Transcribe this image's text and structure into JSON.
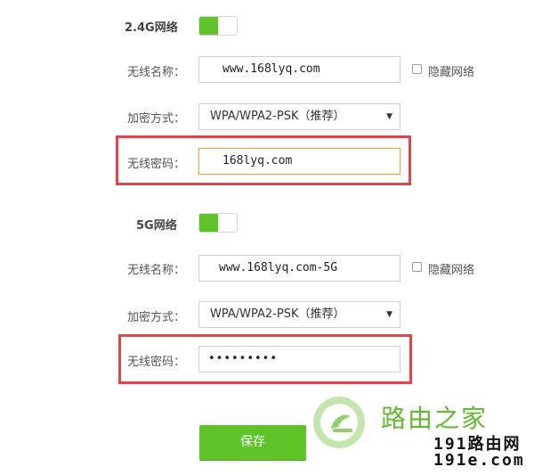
{
  "wifi_24g": {
    "section_label": "2.4G网络",
    "enabled": true,
    "ssid_label": "无线名称：",
    "ssid_value": "www.168lyq.com",
    "hide_label": "隐藏网络",
    "hidden": false,
    "security_label": "加密方式：",
    "security_value": "WPA/WPA2-PSK（推荐）",
    "password_label": "无线密码：",
    "password_value": "168lyq.com"
  },
  "wifi_5g": {
    "section_label": "5G网络",
    "enabled": true,
    "ssid_label": "无线名称：",
    "ssid_value": "www.168lyq.com-5G",
    "hide_label": "隐藏网络",
    "hidden": false,
    "security_label": "加密方式：",
    "security_value": "WPA/WPA2-PSK（推荐）",
    "password_label": "无线密码：",
    "password_masked": "•••••••••"
  },
  "save_label": "保存",
  "watermark": {
    "name": "路由之家",
    "url_line1": "191路由网",
    "url_line2": "191e.com"
  },
  "colors": {
    "accent_green": "#5ec42a",
    "highlight_red": "#e2464c"
  }
}
